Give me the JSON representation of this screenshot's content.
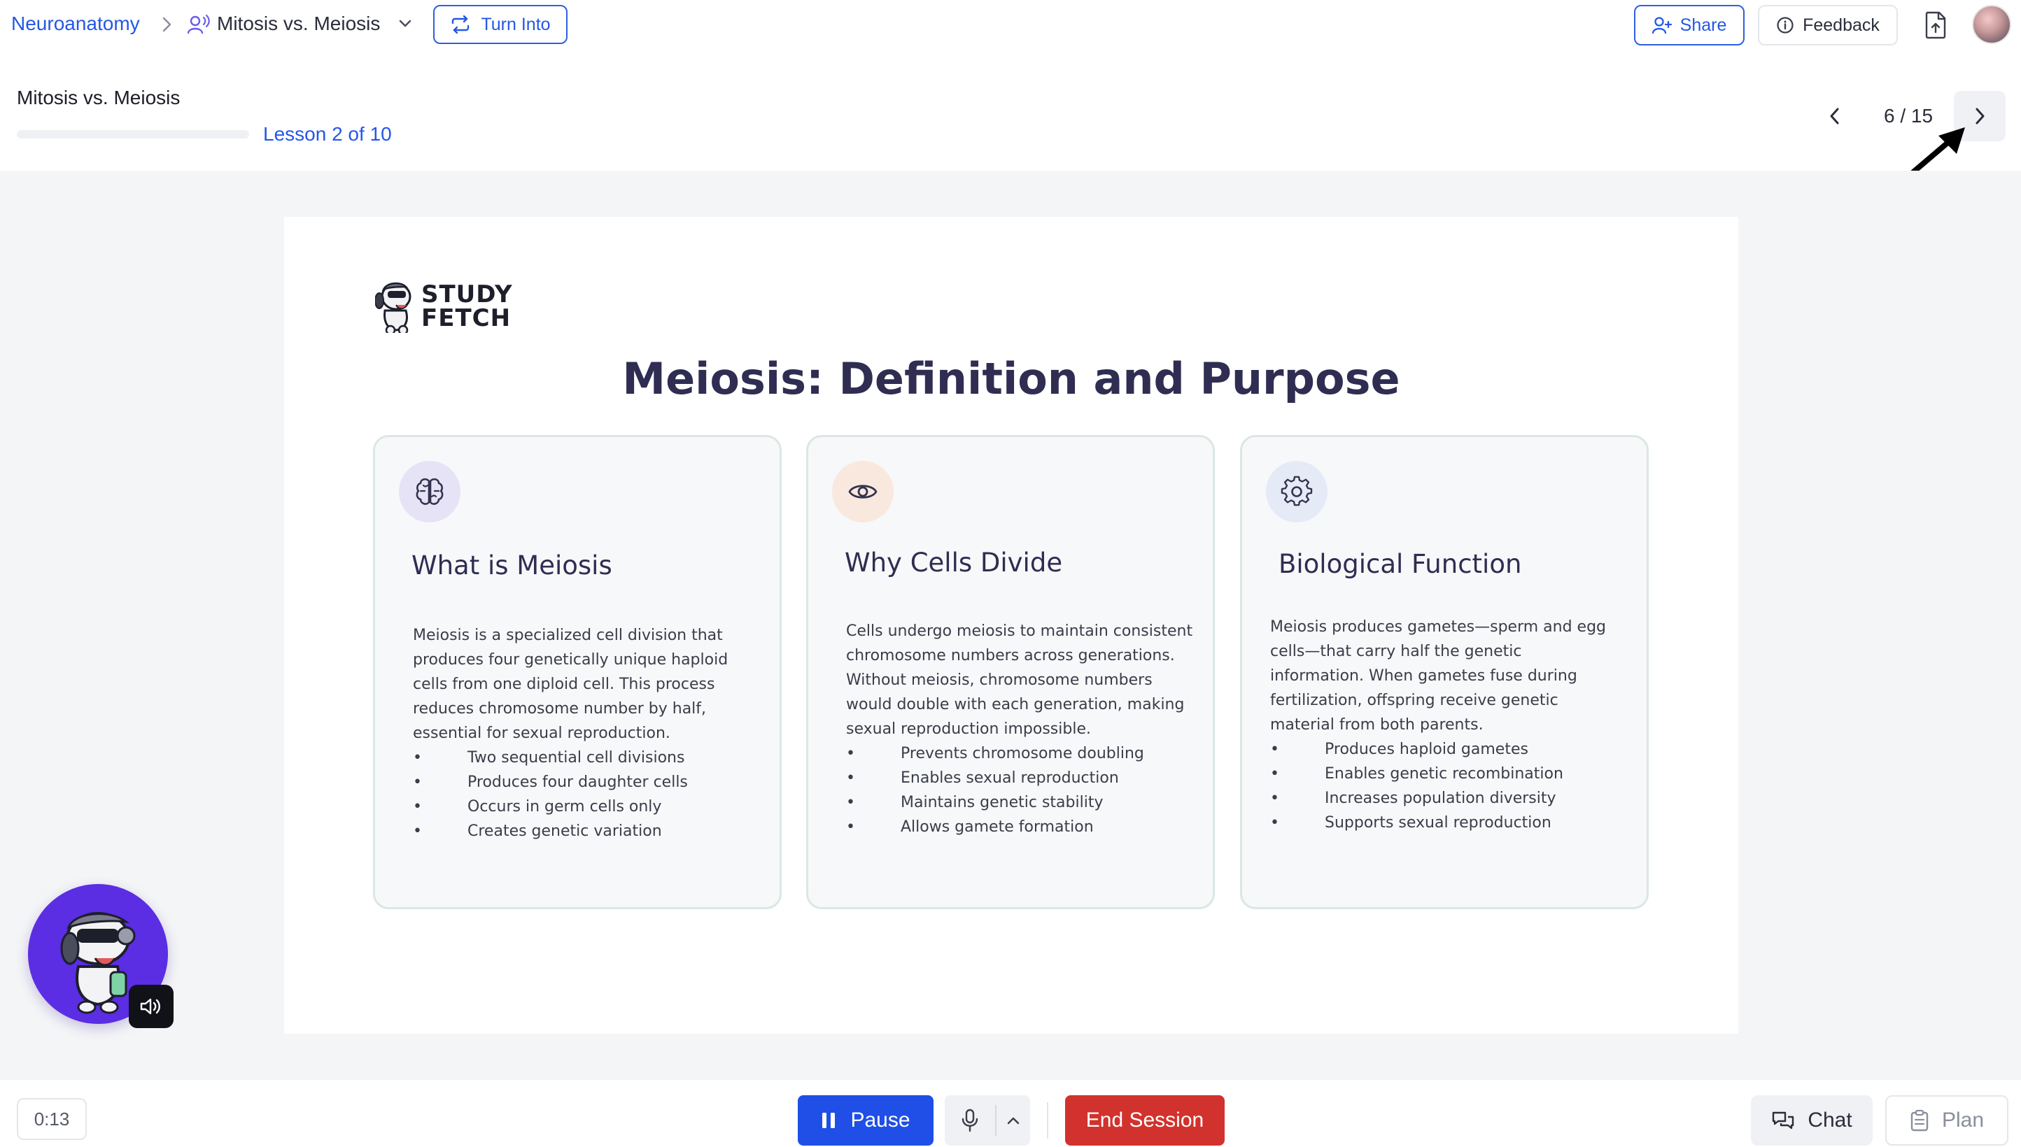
{
  "breadcrumb": {
    "root": "Neuroanatomy",
    "current": "Mitosis vs. Meiosis"
  },
  "toolbar": {
    "turn_into_label": "Turn Into",
    "share_label": "Share",
    "feedback_label": "Feedback"
  },
  "lesson": {
    "title": "Mitosis vs. Meiosis",
    "count_label": "Lesson 2 of 10",
    "progress_fraction": 0.2
  },
  "pager": {
    "label": "6 / 15"
  },
  "slide": {
    "logo_text_line1": "STUDY",
    "logo_text_line2": "FETCH",
    "title": "Meiosis: Definition and Purpose",
    "cards": [
      {
        "icon": "brain-icon",
        "heading": "What is Meiosis",
        "body": "Meiosis is a specialized cell division that produces four genetically unique haploid cells from one diploid cell. This process reduces chromosome number by half, essential for sexual reproduction.",
        "bullets": [
          "Two sequential cell divisions",
          "Produces four daughter cells",
          "Occurs in germ cells only",
          "Creates genetic variation"
        ]
      },
      {
        "icon": "eye-icon",
        "heading": "Why Cells Divide",
        "body": "Cells undergo meiosis to maintain consistent chromosome numbers across generations. Without meiosis, chromosome numbers would double with each generation, making sexual reproduction impossible.",
        "bullets": [
          "Prevents chromosome doubling",
          "Enables sexual reproduction",
          "Maintains genetic stability",
          "Allows gamete formation"
        ]
      },
      {
        "icon": "gear-icon",
        "heading": "Biological Function",
        "body": "Meiosis produces gametes—sperm and egg cells—that carry half the genetic information. When gametes fuse during fertilization, offspring receive genetic material from both parents.",
        "bullets": [
          "Produces haploid gametes",
          "Enables genetic recombination",
          "Increases population diversity",
          "Supports sexual reproduction"
        ]
      }
    ]
  },
  "session": {
    "timer": "0:13",
    "pause_label": "Pause",
    "end_label": "End Session",
    "chat_label": "Chat",
    "plan_label": "Plan"
  },
  "colors": {
    "accent": "#2457e6",
    "danger": "#d2322d",
    "mascot_bg": "#5b2de3",
    "title": "#2f2d52"
  }
}
